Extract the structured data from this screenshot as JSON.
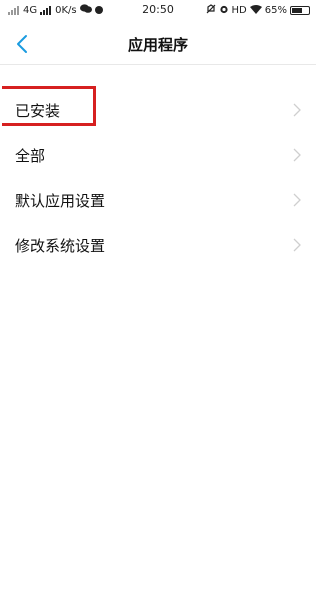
{
  "status_bar": {
    "left_text": "4G",
    "speed": "0K/s",
    "time": "20:50",
    "hd": "HD",
    "battery": "65%",
    "battery_level": 0.65
  },
  "header": {
    "title": "应用程序",
    "back_icon": "chevron-left-icon",
    "accent_color": "#1a9be0"
  },
  "menu": {
    "items": [
      {
        "label": "已安装",
        "highlighted": true
      },
      {
        "label": "全部"
      },
      {
        "label": "默认应用设置"
      },
      {
        "label": "修改系统设置"
      }
    ],
    "highlight_color": "#d62020"
  }
}
